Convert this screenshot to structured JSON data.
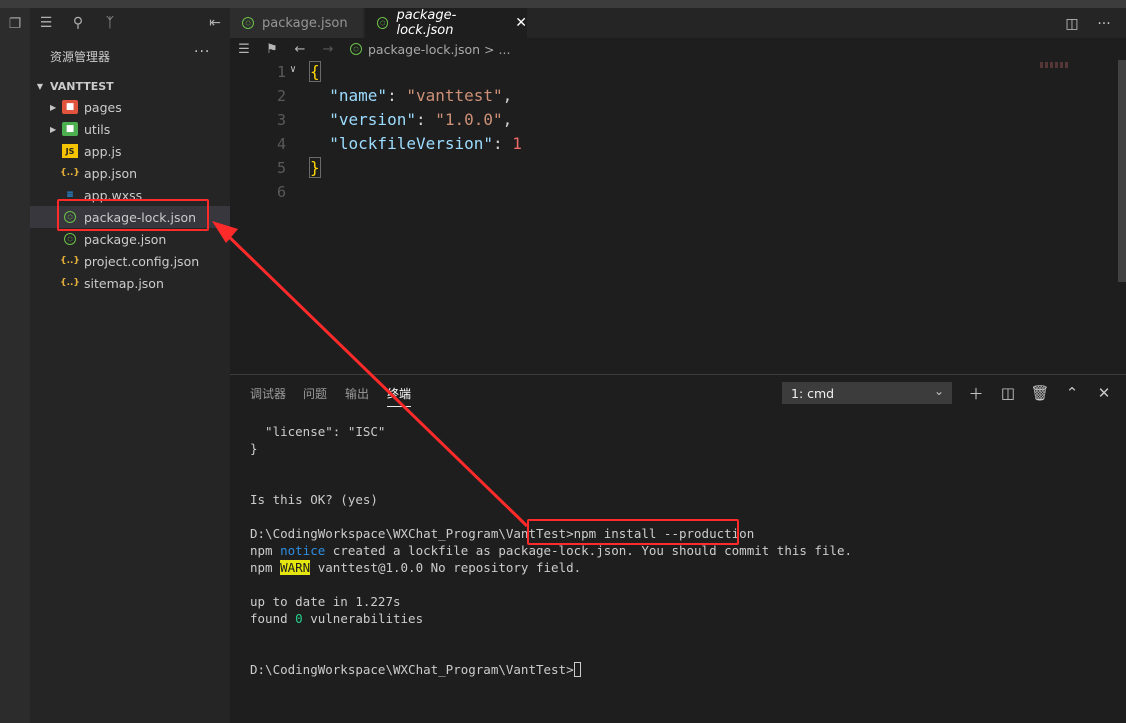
{
  "sidebar": {
    "header": "资源管理器",
    "more": "···",
    "project": "VANTTEST",
    "items": [
      {
        "label": "pages",
        "icon": "folder-pages-icon",
        "folder": true
      },
      {
        "label": "utils",
        "icon": "folder-utils-icon",
        "folder": true
      },
      {
        "label": "app.js",
        "icon": "js-file-icon"
      },
      {
        "label": "app.json",
        "icon": "json-file-icon"
      },
      {
        "label": "app.wxss",
        "icon": "css-file-icon"
      },
      {
        "label": "package-lock.json",
        "icon": "node-file-icon",
        "selected": true
      },
      {
        "label": "package.json",
        "icon": "node-file-icon"
      },
      {
        "label": "project.config.json",
        "icon": "json-file-icon"
      },
      {
        "label": "sitemap.json",
        "icon": "json-file-icon"
      }
    ]
  },
  "tabs": [
    {
      "label": "package.json",
      "active": false
    },
    {
      "label": "package-lock.json",
      "active": true
    }
  ],
  "breadcrumb": {
    "file": "package-lock.json",
    "sep": ">",
    "rest": "..."
  },
  "editor": {
    "line_numbers": [
      "1",
      "2",
      "3",
      "4",
      "5",
      "6"
    ],
    "name_key": "\"name\"",
    "name_val": "\"vanttest\"",
    "version_key": "\"version\"",
    "version_val": "\"1.0.0\"",
    "lock_key": "\"lockfileVersion\"",
    "lock_val": "1"
  },
  "panel": {
    "tabs": [
      "调试器",
      "问题",
      "输出",
      "终端"
    ],
    "active_tab": "终端",
    "terminal_select": "1: cmd",
    "terminal": {
      "l1": "  \"license\": \"ISC\"",
      "l2": "}",
      "l3": "Is this OK? (yes)",
      "l4_path": "D:\\CodingWorkspace\\WXChat_Program\\VantTest>",
      "l4_cmd": "npm install --production",
      "l5_a": "npm ",
      "l5_notice": "notice",
      "l5_b": " created a lockfile as package-lock.json. You should commit this file.",
      "l6_a": "npm ",
      "l6_warn": "WARN",
      "l6_b": " vanttest@1.0.0 No repository field.",
      "l7": "up to date in 1.227s",
      "l8_a": "found ",
      "l8_zero": "0",
      "l8_b": " vulnerabilities",
      "l9_path": "D:\\CodingWorkspace\\WXChat_Program\\VantTest>"
    }
  },
  "colors": {
    "annotation": "#ff2a2a",
    "accent_node": "#6cc04a"
  }
}
